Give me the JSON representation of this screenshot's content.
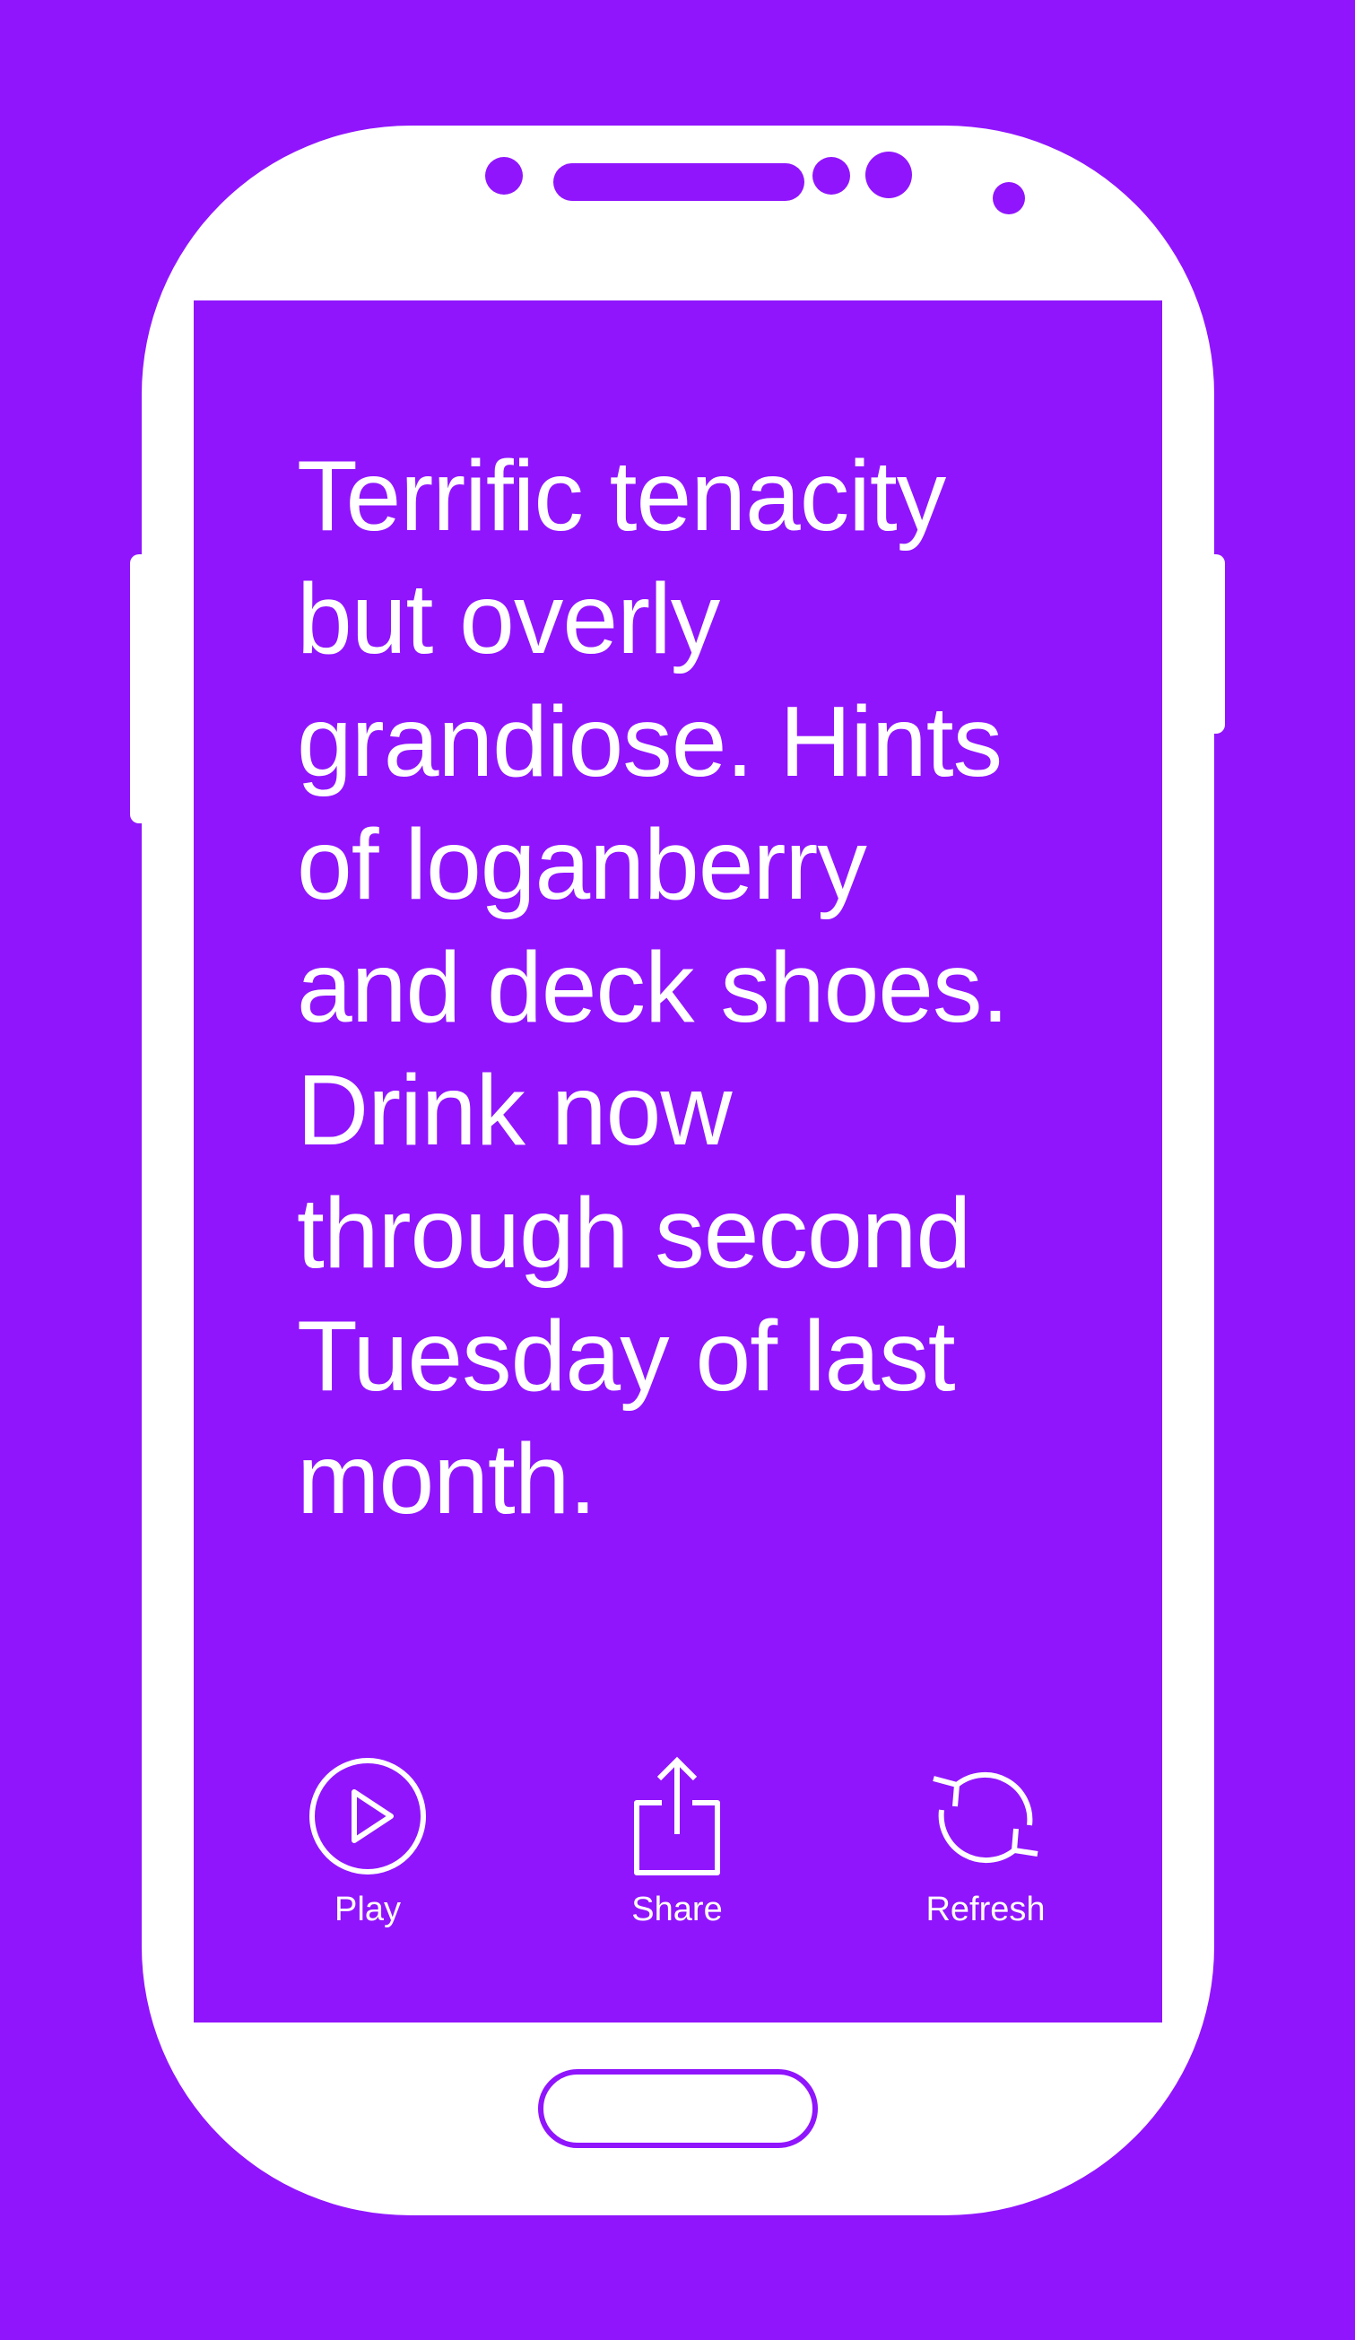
{
  "colors": {
    "background": "#9015FC",
    "device": "#FFFFFF",
    "text": "#FFFFFF"
  },
  "review": {
    "text": "Terrific tenacity\nbut overly\ngrandiose. Hints\nof loganberry\nand deck shoes.\nDrink now\nthrough second\nTuesday of last\nmonth."
  },
  "actions": {
    "play": {
      "label": "Play",
      "icon": "play-circle-icon"
    },
    "share": {
      "label": "Share",
      "icon": "share-icon"
    },
    "refresh": {
      "label": "Refresh",
      "icon": "refresh-icon"
    }
  }
}
